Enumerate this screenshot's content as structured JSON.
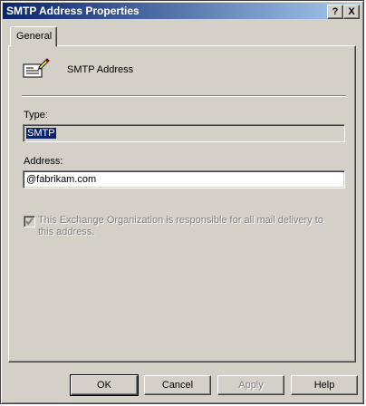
{
  "window": {
    "title": "SMTP Address Properties",
    "help_button": "?",
    "close_button": "X"
  },
  "tabs": [
    {
      "label": "General",
      "selected": true
    }
  ],
  "general": {
    "header_label": "SMTP Address",
    "header_icon": "mail-address-icon",
    "type_label": "Type:",
    "type_value": "SMTP",
    "address_label": "Address:",
    "address_value": "@fabrikam.com",
    "responsible_checkbox": {
      "label": "This Exchange Organization is responsible for all mail delivery to this address.",
      "checked": true,
      "enabled": false
    }
  },
  "buttons": {
    "ok": "OK",
    "cancel": "Cancel",
    "apply": "Apply",
    "help": "Help"
  }
}
